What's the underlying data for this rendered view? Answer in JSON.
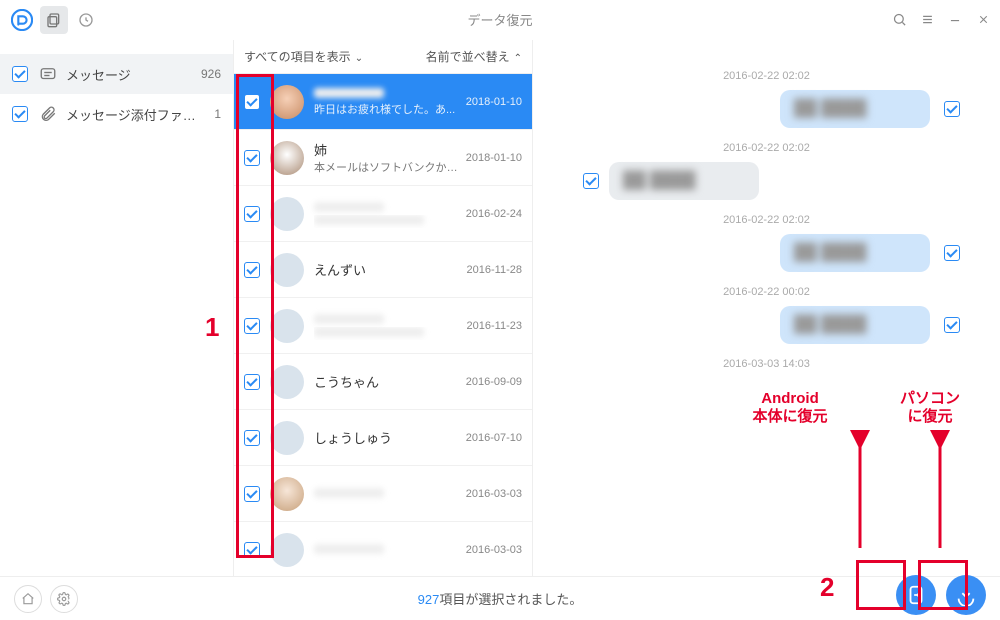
{
  "header": {
    "title": "データ復元"
  },
  "sidebar": {
    "items": [
      {
        "icon": "message",
        "label": "メッセージ",
        "count": "926",
        "selected": true
      },
      {
        "icon": "attachment",
        "label": "メッセージ添付ファ…",
        "count": "1",
        "selected": false
      }
    ]
  },
  "mid": {
    "filter_label": "すべての項目を表示",
    "sort_label": "名前で並べ替え",
    "conversations": [
      {
        "name": "",
        "preview": "昨日はお疲れ様でした。あ...",
        "date": "2018-01-10",
        "avatar": "p1",
        "selected": true,
        "blurred_name": true
      },
      {
        "name": "姉",
        "preview": "本メールはソフトバンクからお...",
        "date": "2018-01-10",
        "avatar": "p2"
      },
      {
        "name": "",
        "preview": "",
        "date": "2016-02-24",
        "blurred_name": true,
        "blurred_preview": true
      },
      {
        "name": "えんずい",
        "preview": "",
        "date": "2016-11-28"
      },
      {
        "name": "",
        "preview": "",
        "date": "2016-11-23",
        "blurred_name": true,
        "blurred_preview": true
      },
      {
        "name": "こうちゃん",
        "preview": "",
        "date": "2016-09-09"
      },
      {
        "name": "しょうしゅう",
        "preview": "",
        "date": "2016-07-10"
      },
      {
        "name": "",
        "preview": "",
        "date": "2016-03-03",
        "avatar": "p8",
        "blurred_name": true
      },
      {
        "name": "",
        "preview": "",
        "date": "2016-03-03",
        "blurred_name": true
      }
    ]
  },
  "chat": {
    "messages": [
      {
        "type": "ts",
        "text": "2016-02-22 02:02"
      },
      {
        "type": "out",
        "check": true
      },
      {
        "type": "ts",
        "text": "2016-02-22 02:02"
      },
      {
        "type": "in",
        "check": true
      },
      {
        "type": "ts",
        "text": "2016-02-22 02:02"
      },
      {
        "type": "out",
        "check": true
      },
      {
        "type": "ts",
        "text": "2016-02-22 00:02"
      },
      {
        "type": "out",
        "check": true
      },
      {
        "type": "ts",
        "text": "2016-03-03 14:03"
      }
    ]
  },
  "footer": {
    "count": "927",
    "suffix": "項目が選択されました。"
  },
  "annotations": {
    "step1": "1",
    "step2": "2",
    "android_line1": "Android",
    "android_line2": "本体に復元",
    "pc_line1": "パソコン",
    "pc_line2": "に復元"
  }
}
